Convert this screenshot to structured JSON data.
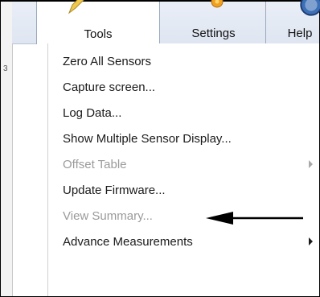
{
  "tabs": [
    {
      "label": "Tools",
      "icon": "pencil-icon"
    },
    {
      "label": "Settings",
      "icon": "gear-icon"
    },
    {
      "label": "Help",
      "icon": "help-icon"
    }
  ],
  "menu": {
    "items": [
      {
        "label": "Zero All Sensors",
        "enabled": true,
        "submenu": false
      },
      {
        "label": "Capture screen...",
        "enabled": true,
        "submenu": false
      },
      {
        "label": "Log Data...",
        "enabled": true,
        "submenu": false
      },
      {
        "label": "Show Multiple Sensor Display...",
        "enabled": true,
        "submenu": false
      },
      {
        "label": "Offset Table",
        "enabled": false,
        "submenu": true
      },
      {
        "label": "Update Firmware...",
        "enabled": true,
        "submenu": false
      },
      {
        "label": "View Summary...",
        "enabled": false,
        "submenu": false
      },
      {
        "label": "Advance Measurements",
        "enabled": true,
        "submenu": true
      }
    ]
  },
  "colors": {
    "ribbon": "#dfe6f1",
    "text": "#1a1a1a",
    "disabled_text": "#9a9a9a",
    "annotation_arrow": "#000000"
  }
}
